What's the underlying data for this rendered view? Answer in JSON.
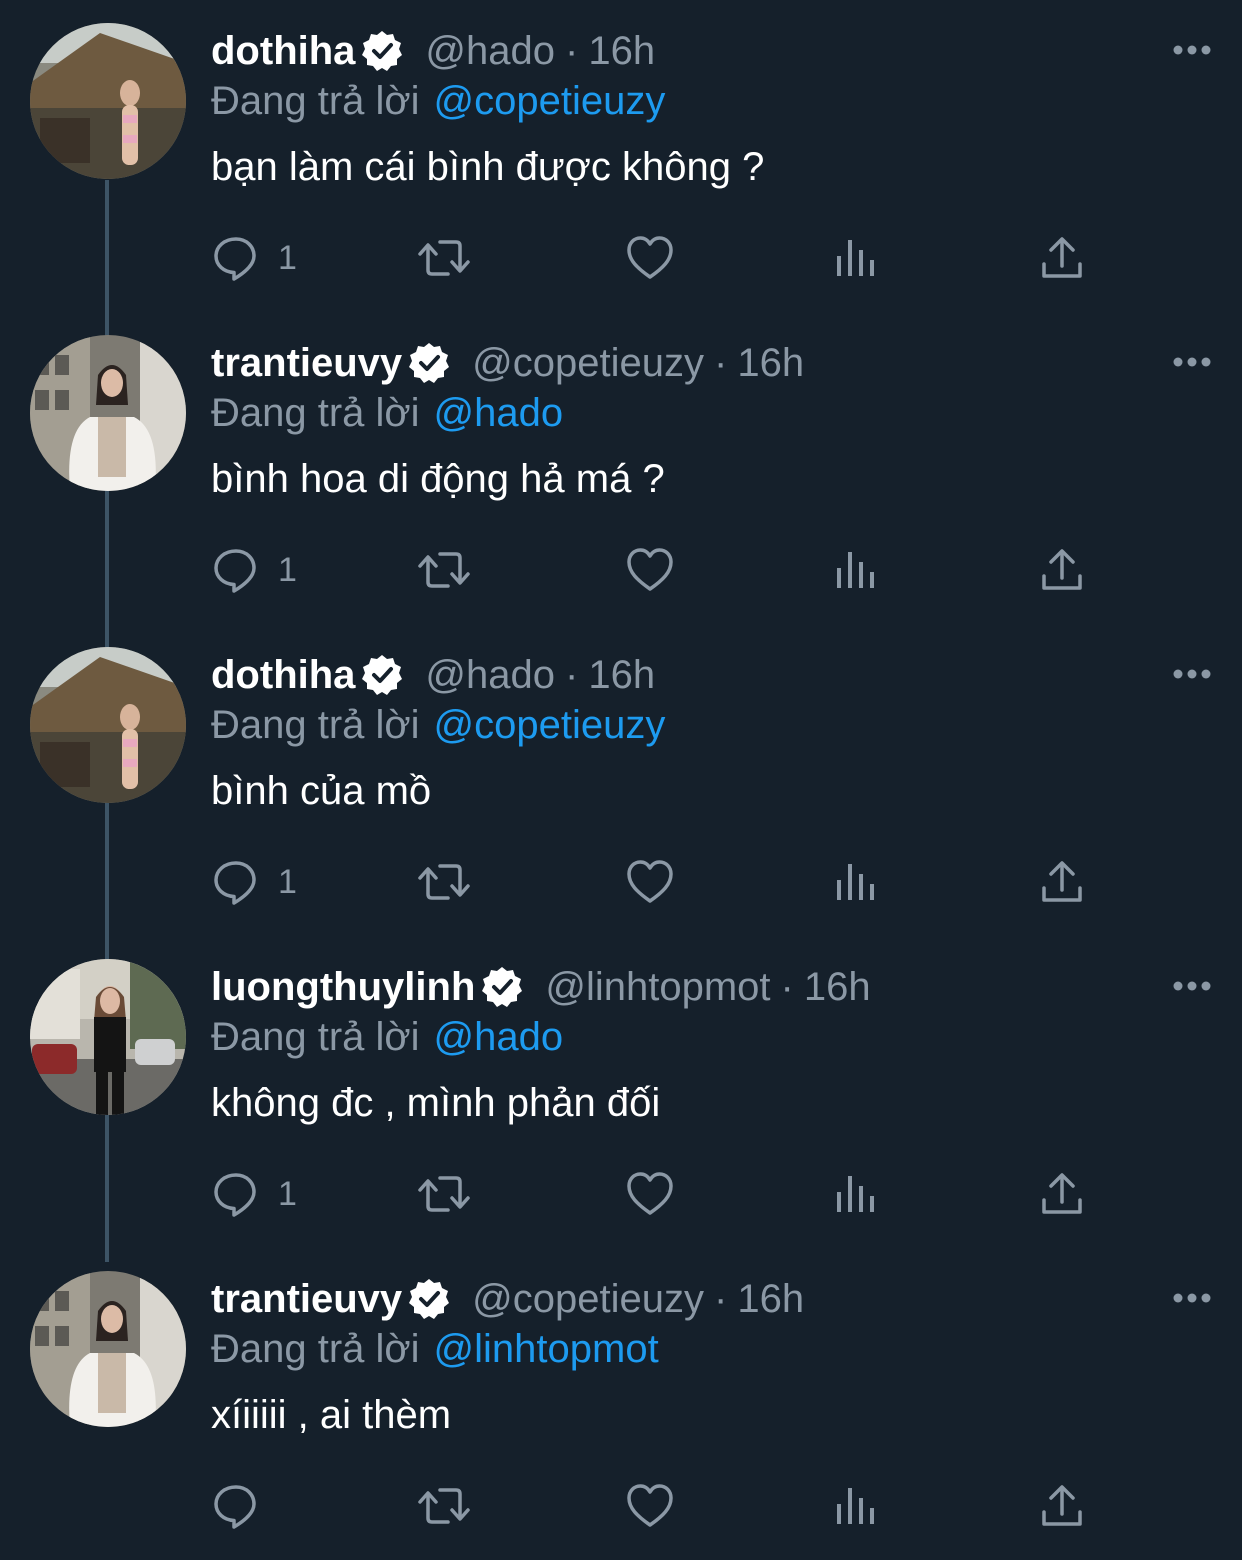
{
  "colors": {
    "background": "#15202b",
    "text_primary": "#ffffff",
    "text_secondary": "#8b98a5",
    "mention": "#1d9bf0",
    "thread_line": "#3d5466"
  },
  "tweets": [
    {
      "name": "dothiha",
      "handle": "@hado",
      "separator": "·",
      "time": "16h",
      "reply_prefix": "Đang trả lời",
      "reply_to": "@copetieuzy",
      "text": "bạn làm cái bình được không ?",
      "reply_count": "1",
      "verified_icon": "verified-badge-icon",
      "more_icon": "more-options-icon"
    },
    {
      "name": "trantieuvy",
      "handle": "@copetieuzy",
      "separator": "·",
      "time": "16h",
      "reply_prefix": "Đang trả lời",
      "reply_to": "@hado",
      "text": "bình hoa di động hả má ?",
      "reply_count": "1",
      "verified_icon": "verified-badge-icon",
      "more_icon": "more-options-icon"
    },
    {
      "name": "dothiha",
      "handle": "@hado",
      "separator": "·",
      "time": "16h",
      "reply_prefix": "Đang trả lời",
      "reply_to": "@copetieuzy",
      "text": "bình của mồ",
      "reply_count": "1",
      "verified_icon": "verified-badge-icon",
      "more_icon": "more-options-icon"
    },
    {
      "name": "luongthuylinh",
      "handle": "@linhtopmot",
      "separator": "·",
      "time": "16h",
      "reply_prefix": "Đang trả lời",
      "reply_to": "@hado",
      "text": "không đc , mình phản đối",
      "reply_count": "1",
      "verified_icon": "verified-badge-icon",
      "more_icon": "more-options-icon"
    },
    {
      "name": "trantieuvy",
      "handle": "@copetieuzy",
      "separator": "·",
      "time": "16h",
      "reply_prefix": "Đang trả lời",
      "reply_to": "@linhtopmot",
      "text": "xíiiiii , ai thèm",
      "reply_count": "",
      "verified_icon": "verified-badge-icon",
      "more_icon": "more-options-icon"
    }
  ],
  "action_icons": [
    "reply-icon",
    "retweet-icon",
    "like-icon",
    "views-icon",
    "share-icon"
  ]
}
